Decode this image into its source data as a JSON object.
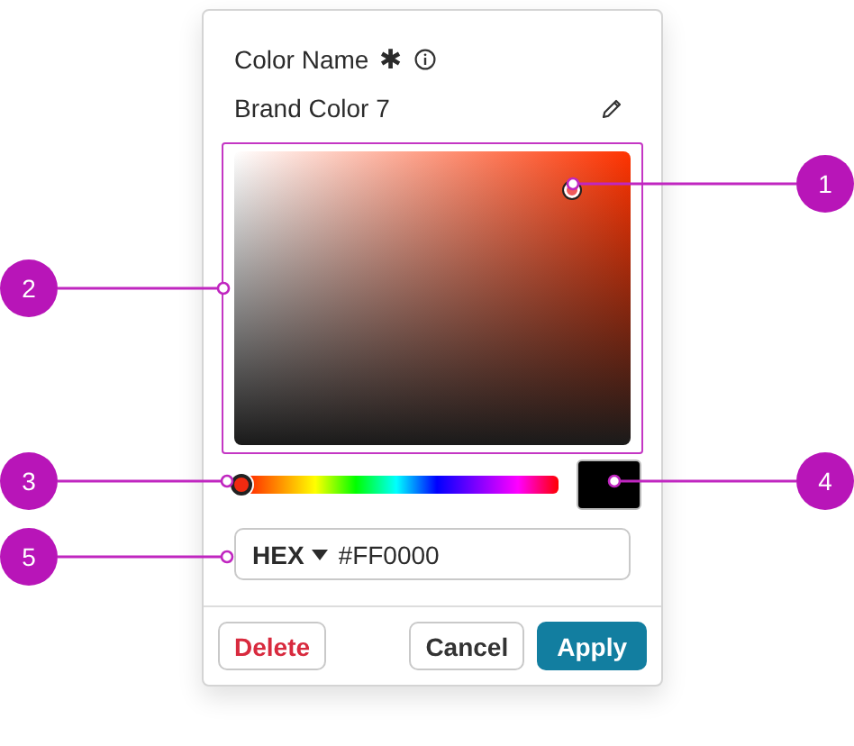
{
  "field": {
    "label": "Color Name",
    "required_mark": "✱",
    "value": "Brand Color 7"
  },
  "hue_slider": {
    "level": 0.02
  },
  "color_input": {
    "format": "HEX",
    "value": "#FF0000"
  },
  "buttons": [
    {
      "label": "Delete",
      "kind": "danger"
    },
    {
      "label": "Cancel",
      "kind": "secondary"
    },
    {
      "label": "Apply",
      "kind": "primary"
    }
  ],
  "callouts": [
    {
      "label": "1"
    },
    {
      "label": "2"
    },
    {
      "label": "3"
    },
    {
      "label": "4"
    },
    {
      "label": "5"
    }
  ]
}
